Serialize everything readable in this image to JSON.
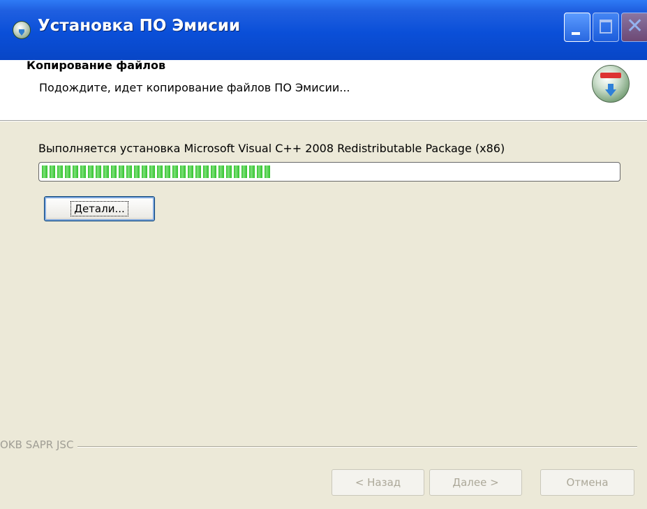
{
  "window": {
    "title": "Установка ПО Эмисии",
    "controls": [
      "minimize",
      "maximize",
      "close"
    ]
  },
  "header": {
    "title": "Копирование файлов",
    "subtitle": "Подождите, идет копирование файлов ПО Эмисии..."
  },
  "main": {
    "status_text": "Выполняется установка Microsoft Visual C++ 2008 Redistributable Package (x86)",
    "progress_fraction": 0.4,
    "details_button": "Детали..."
  },
  "footer": {
    "brand": "OKB SAPR JSC",
    "back_button": "< Назад",
    "next_button": "Далее >",
    "cancel_button": "Отмена"
  },
  "colors": {
    "title_bar": "#0a4fd8",
    "progress_green": "#2fc22a",
    "dialog_background": "#ece9d8"
  },
  "icons": {
    "app": "installer-globe-icon",
    "header": "installer-globe-download-icon",
    "minimize": "minimize-icon",
    "maximize": "maximize-icon",
    "close": "close-icon"
  }
}
